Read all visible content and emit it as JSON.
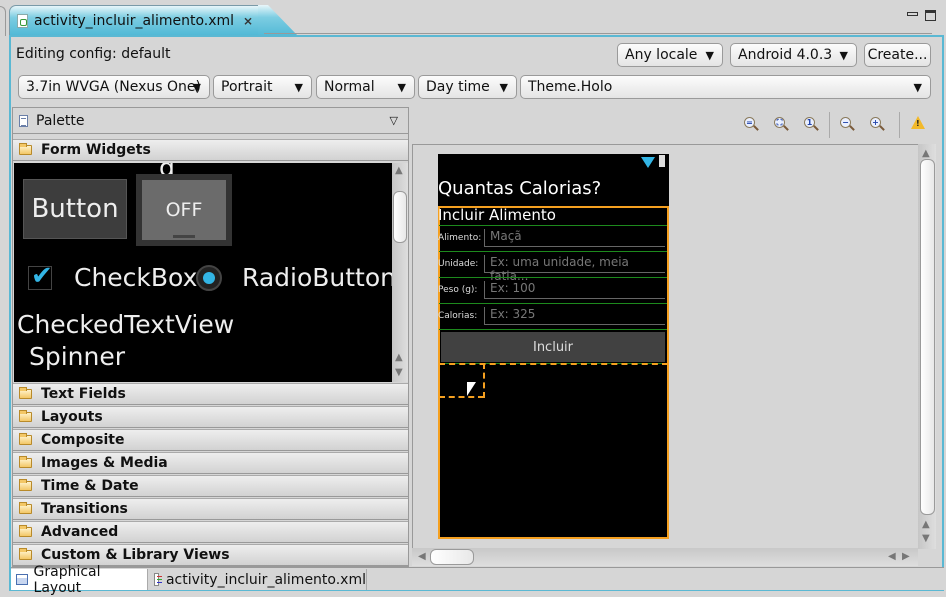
{
  "editor_tab": {
    "title": "activity_incluir_alimento.xml",
    "close_icon": "close-icon"
  },
  "window_controls": {
    "minimize": "minimize-icon",
    "maximize": "maximize-icon"
  },
  "config": {
    "editing_label": "Editing config: default",
    "locale": "Any locale",
    "api_level": "Android 4.0.3",
    "create_button": "Create...",
    "device": "3.7in WVGA (Nexus One)",
    "orientation": "Portrait",
    "dock_mode": "Normal",
    "night_mode": "Day time",
    "theme": "Theme.Holo",
    "dropdown_arrow": "▼"
  },
  "palette": {
    "title": "Palette",
    "menu_icon": "▽",
    "open_category": "Form Widgets",
    "preview": {
      "button": "Button",
      "toggle": "OFF",
      "checkbox": "CheckBox",
      "radio": "RadioButton",
      "checked_text_view": "CheckedTextView",
      "spinner": "Spinner",
      "cutoff_text": "g"
    },
    "categories": [
      "Text Fields",
      "Layouts",
      "Composite",
      "Images & Media",
      "Time & Date",
      "Transitions",
      "Advanced",
      "Custom & Library Views"
    ]
  },
  "canvas_toolbar": {
    "zoom_real_size": "=",
    "zoom_fit": "⛶",
    "zoom_100": "1",
    "zoom_out": "−",
    "zoom_in": "+",
    "warning": "!"
  },
  "device_screen": {
    "app_title": "Quantas Calorias?",
    "heading": "Incluir Alimento",
    "rows": [
      {
        "label": "Alimento:",
        "hint": "Maçã"
      },
      {
        "label": "Unidade:",
        "hint": "Ex: uma unidade, meia fatia..."
      },
      {
        "label": "Peso (g):",
        "hint": "Ex: 100"
      },
      {
        "label": "Calorias:",
        "hint": "Ex: 325"
      }
    ],
    "button": "Incluir"
  },
  "bottom_tabs": [
    {
      "label": "Graphical Layout",
      "active": true
    },
    {
      "label": "activity_incluir_alimento.xml",
      "active": false
    }
  ]
}
